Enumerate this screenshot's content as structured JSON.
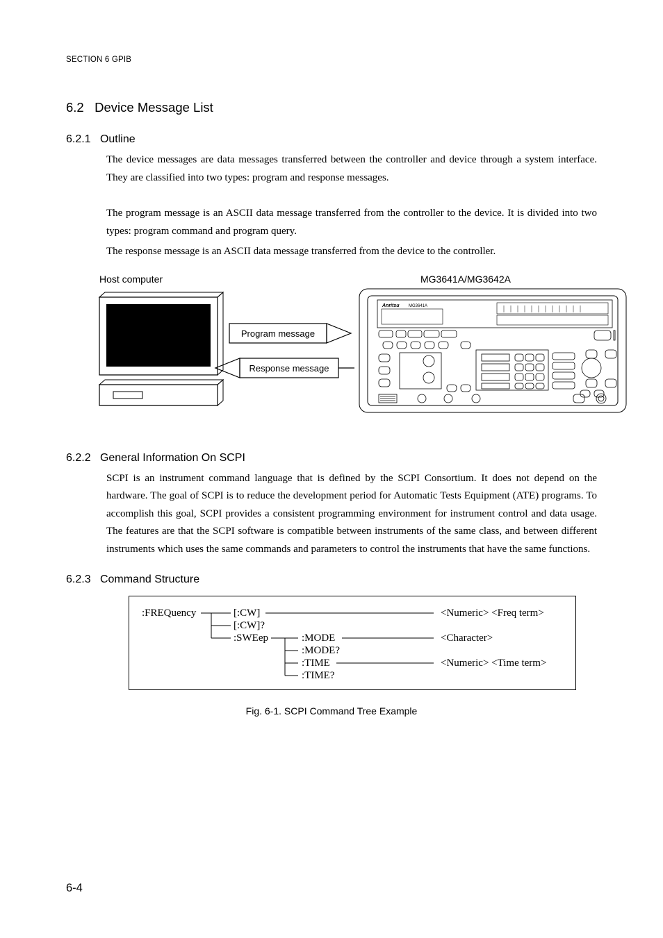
{
  "section_header": "SECTION 6    GPIB",
  "s62": {
    "num": "6.2",
    "title": "Device Message List"
  },
  "s621": {
    "num": "6.2.1",
    "title": "Outline",
    "p1": "The device messages are data messages transferred between the controller and device through a system interface. They are classified into two types: program and response messages.",
    "p2": "The program message is an ASCII data message transferred from the controller to the device.  It is divided into two types: program command and program query.",
    "p3": "The response message is an ASCII data message transferred from the device to the controller."
  },
  "illus": {
    "host_label": "Host computer",
    "device_label": "MG3641A/MG3642A",
    "program_msg": "Program message",
    "response_msg": "Response message",
    "device_brand": "Anritsu",
    "device_model": "MG3641A"
  },
  "s622": {
    "num": "6.2.2",
    "title": "General Information On SCPI",
    "p1": "SCPI is an instrument command language that is defined by the SCPI Consortium.  It does not depend on the hardware.  The goal of SCPI is to reduce the development period for Automatic Tests Equipment (ATE) programs.  To accomplish this goal, SCPI provides a consistent programming environment for instrument control and data usage.  The features are that the SCPI software is compatible between instruments of the same class, and between different instruments which uses the same commands and parameters to control the instruments that have the same functions."
  },
  "s623": {
    "num": "6.2.3",
    "title": "Command Structure"
  },
  "tree": {
    "freq": ":FREQuency",
    "cw": "[:CW]",
    "cwq": "[:CW]?",
    "swe": ":SWEep",
    "mode": ":MODE",
    "modeq": ":MODE?",
    "time": ":TIME",
    "timeq": ":TIME?",
    "num_freq": "<Numeric> <Freq term>",
    "char": "<Character>",
    "num_time": "<Numeric> <Time term>"
  },
  "fig_caption": "Fig. 6-1.  SCPI Command Tree Example",
  "page_num": "6-4"
}
